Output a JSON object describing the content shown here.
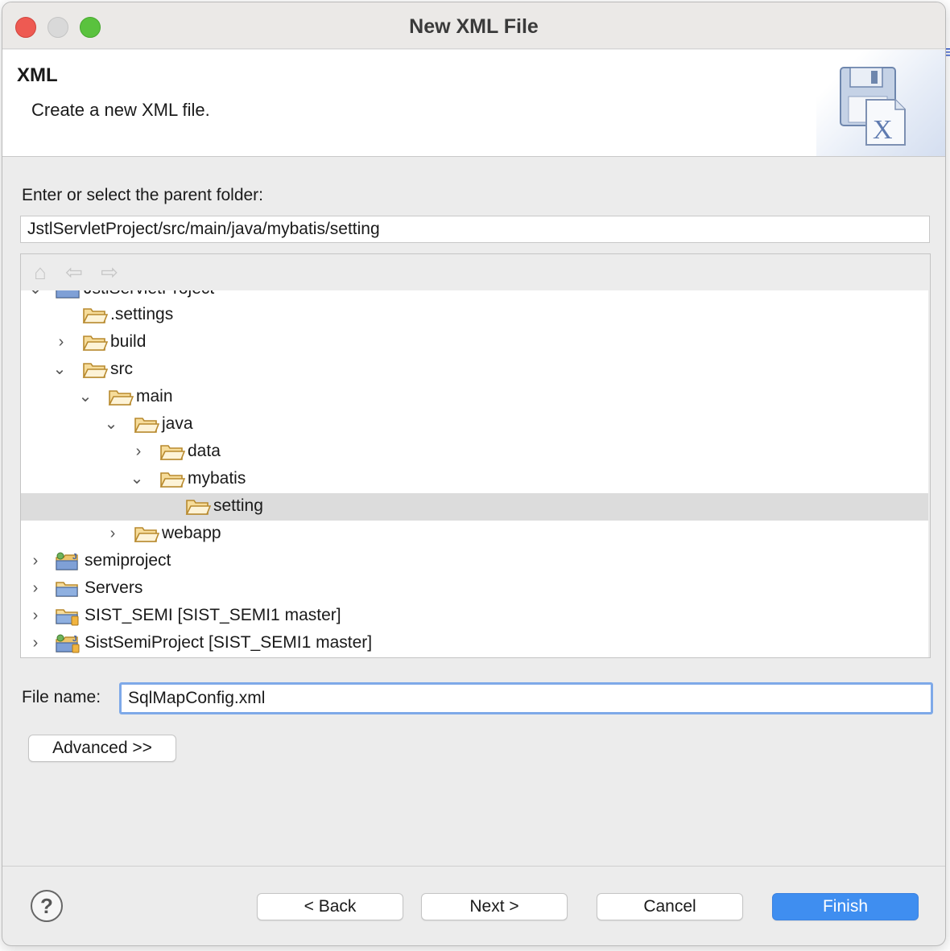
{
  "window": {
    "title": "New XML File"
  },
  "header": {
    "title": "XML",
    "description": "Create a new XML file.",
    "banner_icon": "xml-file-icon"
  },
  "parent_folder": {
    "label": "Enter or select the parent folder:",
    "value": "JstlServletProject/src/main/java/mybatis/setting"
  },
  "tree_toolbar": {
    "home_icon": "home-icon",
    "back_icon": "back-arrow-icon",
    "forward_icon": "forward-arrow-icon"
  },
  "tree": {
    "items": [
      {
        "label": "JstlServletProject",
        "depth": 0,
        "expander": "expanded",
        "icon": "java-project-icon"
      },
      {
        "label": ".settings",
        "depth": 1,
        "expander": "none",
        "icon": "folder-icon"
      },
      {
        "label": "build",
        "depth": 1,
        "expander": "collapsed",
        "icon": "folder-icon"
      },
      {
        "label": "src",
        "depth": 1,
        "expander": "expanded",
        "icon": "folder-icon"
      },
      {
        "label": "main",
        "depth": 2,
        "expander": "expanded",
        "icon": "folder-icon"
      },
      {
        "label": "java",
        "depth": 3,
        "expander": "expanded",
        "icon": "folder-icon"
      },
      {
        "label": "data",
        "depth": 4,
        "expander": "collapsed",
        "icon": "folder-icon"
      },
      {
        "label": "mybatis",
        "depth": 4,
        "expander": "expanded",
        "icon": "folder-icon"
      },
      {
        "label": "setting",
        "depth": 5,
        "expander": "none",
        "icon": "folder-icon",
        "selected": true
      },
      {
        "label": "webapp",
        "depth": 3,
        "expander": "collapsed",
        "icon": "folder-icon"
      },
      {
        "label": "semiproject",
        "depth": 0,
        "expander": "collapsed",
        "icon": "java-project-icon"
      },
      {
        "label": "Servers",
        "depth": 0,
        "expander": "collapsed",
        "icon": "project-folder-icon"
      },
      {
        "label": "SIST_SEMI [SIST_SEMI1 master]",
        "depth": 0,
        "expander": "collapsed",
        "icon": "git-project-icon"
      },
      {
        "label": "SistSemiProject [SIST_SEMI1 master]",
        "depth": 0,
        "expander": "collapsed",
        "icon": "git-java-project-icon"
      }
    ]
  },
  "file_name": {
    "label": "File name:",
    "value": "SqlMapConfig.xml"
  },
  "buttons": {
    "advanced": "Advanced >>",
    "back": "< Back",
    "next": "Next >",
    "cancel": "Cancel",
    "finish": "Finish",
    "help": "?"
  },
  "colors": {
    "accent": "#3f8ef0",
    "folder": "#e8b552",
    "selection": "#dcdcdc"
  }
}
